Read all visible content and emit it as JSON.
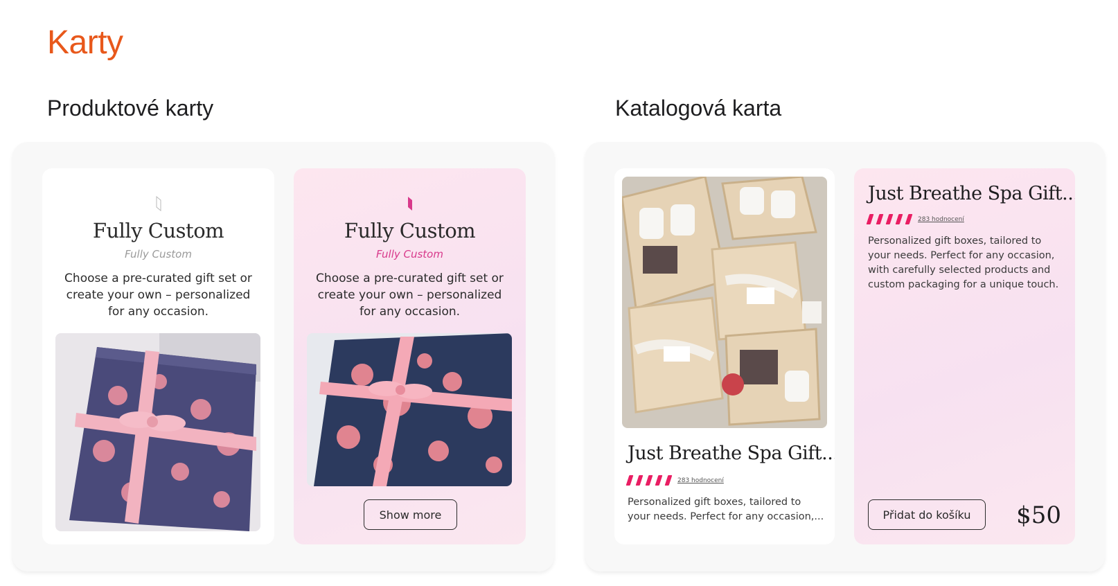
{
  "page": {
    "title": "Karty"
  },
  "sections": {
    "product": {
      "heading": "Produktové karty"
    },
    "catalog": {
      "heading": "Katalogová karta"
    }
  },
  "product_cards": [
    {
      "variant": "white",
      "icon": "leaf-outline-icon",
      "title": "Fully Custom",
      "subtitle": "Fully Custom",
      "description": "Choose a pre-curated gift set or create your own – personalized for any occasion.",
      "image": "gift-box-photo"
    },
    {
      "variant": "pink",
      "icon": "leaf-filled-icon",
      "title": "Fully Custom",
      "subtitle": "Fully Custom",
      "description": "Choose a pre-curated gift set or create your own – personalized for any occasion.",
      "image": "gift-box-photo",
      "button": "Show more"
    }
  ],
  "catalog_cards": [
    {
      "variant": "white",
      "image": "spa-gift-boxes-photo",
      "title": "Just Breathe Spa Gift...",
      "rating": 5,
      "rating_count": "283 hodnocení",
      "description": "Personalized gift boxes, tailored to your needs. Perfect for any occasion,..."
    },
    {
      "variant": "pink",
      "title": "Just Breathe Spa Gift...",
      "rating": 5,
      "rating_count": "283 hodnocení",
      "description": "Personalized gift boxes, tailored to your needs. Perfect for any occasion, with carefully selected products and custom packaging for a unique touch.",
      "button": "Přidat do košíku",
      "price": "$50"
    }
  ],
  "colors": {
    "accent_orange": "#e8581b",
    "pink_accent": "#d8398b",
    "star_pink": "#e91e63",
    "card_pink_bg": "#fbe4ef",
    "panel_bg": "#f8f8f8"
  }
}
